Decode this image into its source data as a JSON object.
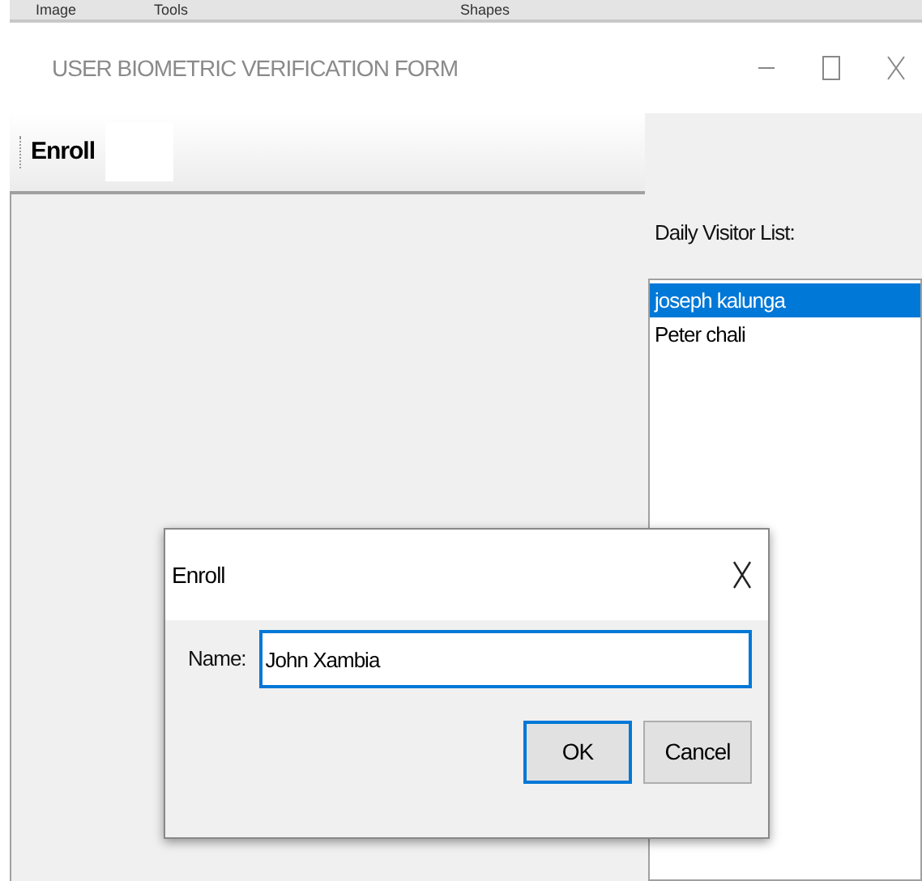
{
  "menu_strip": [
    "Image",
    "Tools",
    "Shapes"
  ],
  "window": {
    "title": "USER BIOMETRIC VERIFICATION FORM"
  },
  "toolbar": {
    "items": [
      {
        "label": "Enroll"
      }
    ]
  },
  "visitor_list": {
    "label": "Daily Visitor List:",
    "items": [
      {
        "name": "joseph kalunga",
        "selected": true
      },
      {
        "name": "Peter chali",
        "selected": false
      }
    ]
  },
  "dialog": {
    "title": "Enroll",
    "field_label": "Name:",
    "value": "John Xambia",
    "buttons": [
      {
        "label": "OK",
        "default": true
      },
      {
        "label": "Cancel",
        "default": false
      }
    ]
  }
}
